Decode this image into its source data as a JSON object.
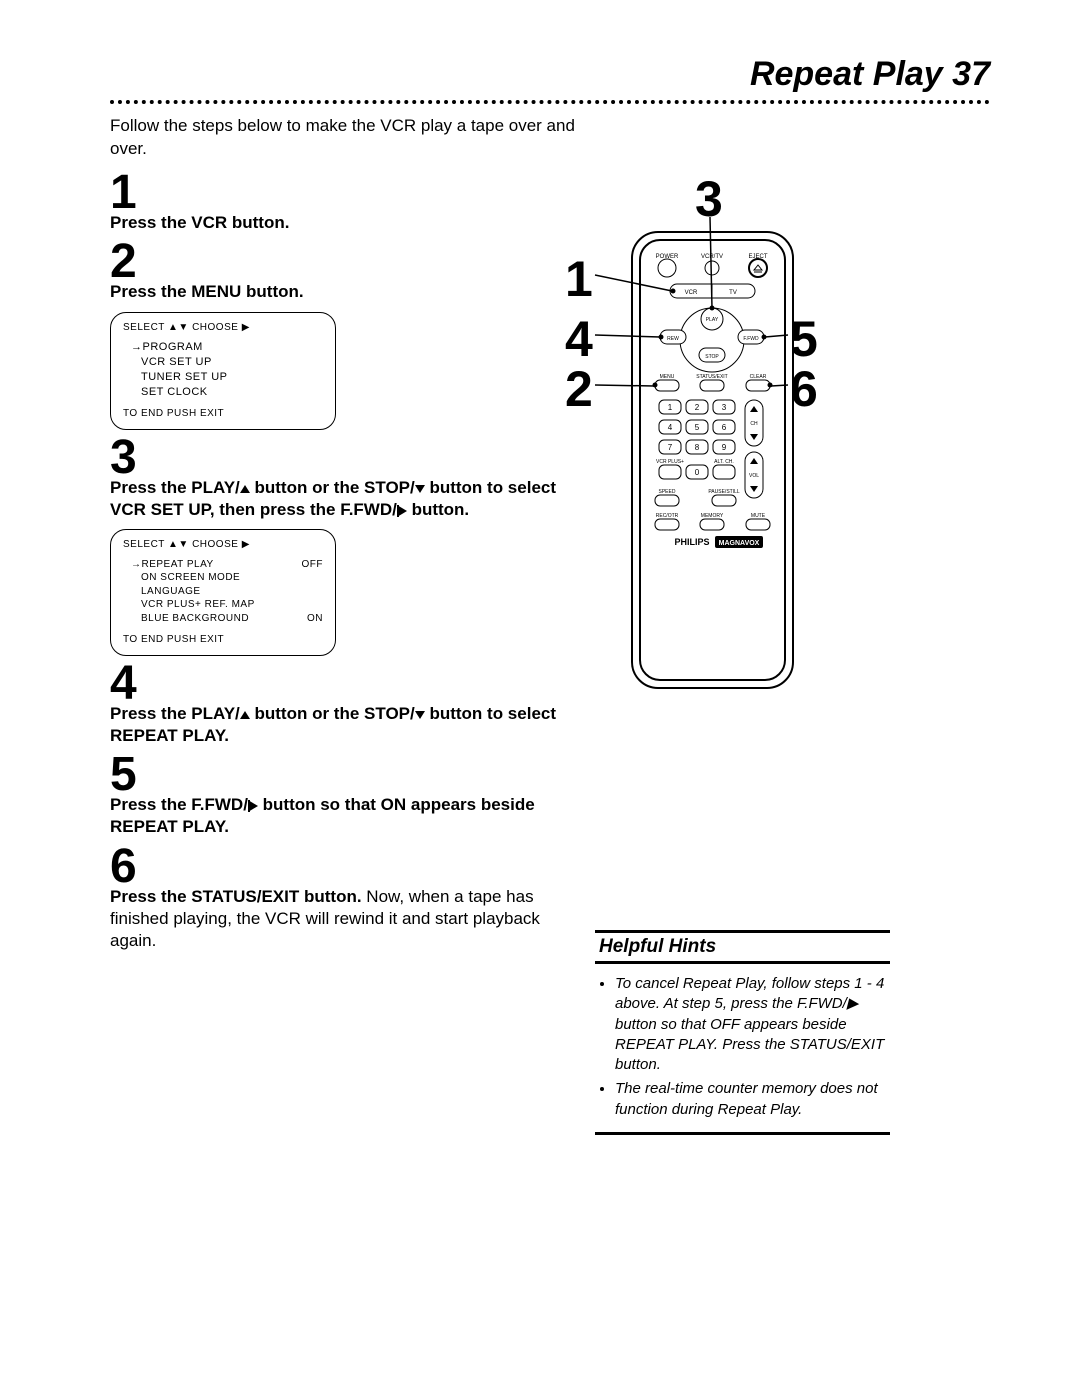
{
  "header": {
    "title": "Repeat Play",
    "page_number": "37"
  },
  "intro": "Follow the steps below to make the VCR play a tape over and over.",
  "steps": {
    "s1": {
      "num": "1",
      "text": "Press the VCR button."
    },
    "s2": {
      "num": "2",
      "text": "Press the MENU button."
    },
    "s3": {
      "num": "3",
      "text_a": "Press the PLAY/",
      "text_b": " button or the STOP/",
      "text_c": " button to select VCR SET UP, then press the F.FWD/",
      "text_d": " button."
    },
    "s4": {
      "num": "4",
      "text_a": "Press the PLAY/",
      "text_b": " button or the STOP/",
      "text_c": " button to select REPEAT PLAY."
    },
    "s5": {
      "num": "5",
      "text_a": "Press the F.FWD/",
      "text_b": " button so that ON appears beside REPEAT PLAY."
    },
    "s6": {
      "num": "6",
      "bold": "Press the STATUS/EXIT button.",
      "rest": " Now, when a tape has finished playing, the VCR will rewind it and start playback again."
    }
  },
  "osd_a": {
    "header": "SELECT ▲▼ CHOOSE ▶",
    "items": [
      "→PROGRAM",
      "VCR SET UP",
      "TUNER SET UP",
      "SET CLOCK"
    ],
    "footer": "TO END PUSH EXIT"
  },
  "osd_b": {
    "header": "SELECT ▲▼ CHOOSE ▶",
    "items": [
      {
        "label": "→REPEAT PLAY",
        "value": "OFF"
      },
      {
        "label": "ON SCREEN MODE",
        "value": ""
      },
      {
        "label": "LANGUAGE",
        "value": ""
      },
      {
        "label": "VCR PLUS+ REF. MAP",
        "value": ""
      },
      {
        "label": "BLUE BACKGROUND",
        "value": "ON"
      }
    ],
    "footer": "TO END PUSH EXIT"
  },
  "remote": {
    "callouts": {
      "c1": "1",
      "c2": "2",
      "c3": "3",
      "c4": "4",
      "c5": "5",
      "c6": "6"
    },
    "labels": {
      "power": "POWER",
      "vcrtv": "VCR/TV",
      "eject": "EJECT",
      "vcr": "VCR",
      "tv": "TV",
      "play": "PLAY",
      "rew": "REW",
      "ffwd": "F.FWD",
      "stop": "STOP",
      "menu": "MENU",
      "status": "STATUS/EXIT",
      "clear": "CLEAR",
      "vcrplus": "VCR PLUS+",
      "altch": "ALT. CH.",
      "ch": "CH",
      "vol": "VOL",
      "speed": "SPEED",
      "pause": "PAUSE/STILL",
      "recotr": "REC/OTR",
      "memory": "MEMORY",
      "mute": "MUTE",
      "brand1": "PHILIPS",
      "brand2": "MAGNAVOX",
      "d1": "1",
      "d2": "2",
      "d3": "3",
      "d4": "4",
      "d5": "5",
      "d6": "6",
      "d7": "7",
      "d8": "8",
      "d9": "9",
      "d0": "0"
    }
  },
  "hints": {
    "title": "Helpful Hints",
    "items": [
      "To cancel Repeat Play, follow steps 1 - 4 above. At step 5, press the F.FWD/▶ button so that OFF appears beside REPEAT PLAY. Press the STATUS/EXIT button.",
      "The real-time counter memory does not function during Repeat Play."
    ]
  }
}
